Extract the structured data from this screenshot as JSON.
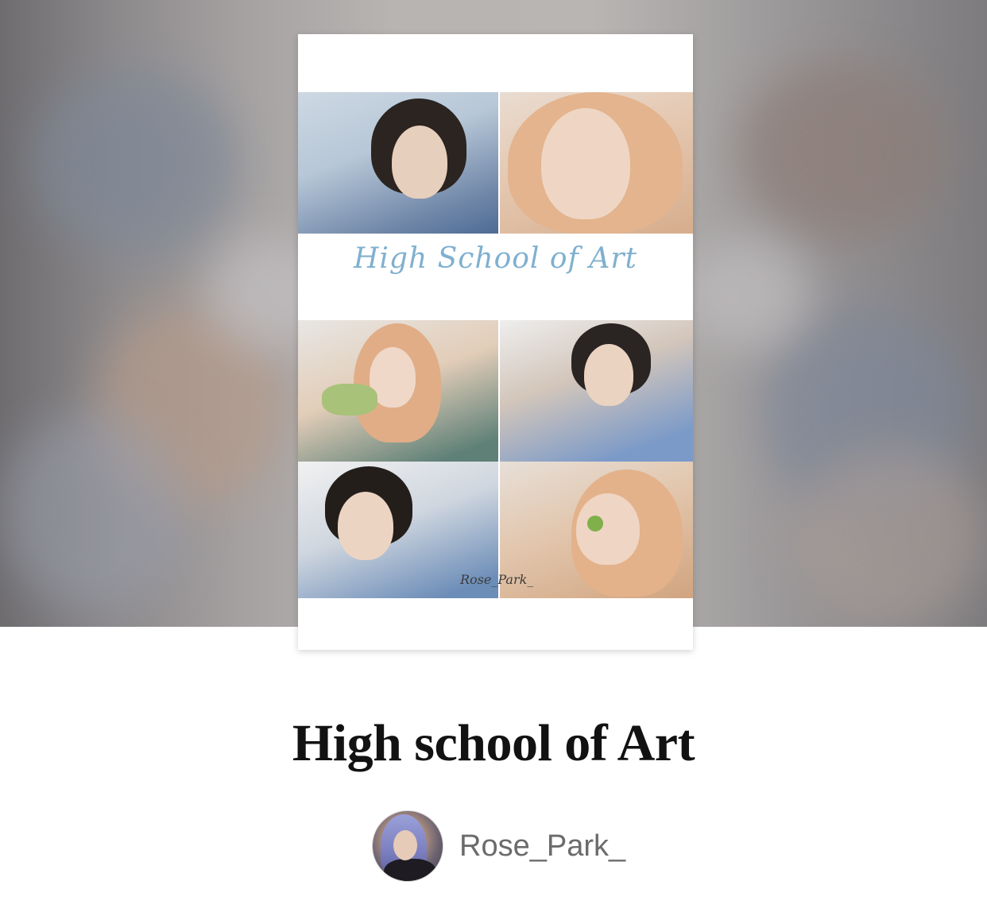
{
  "story": {
    "title": "High school of Art",
    "author": {
      "username": "Rose_Park_"
    },
    "cover": {
      "script_title": "High School of Art",
      "credit": "Rose_Park_"
    }
  },
  "colors": {
    "title_text": "#121212",
    "author_text": "#6b6b6b",
    "cover_script": "#7fb0cf",
    "page_bg": "#ffffff"
  }
}
